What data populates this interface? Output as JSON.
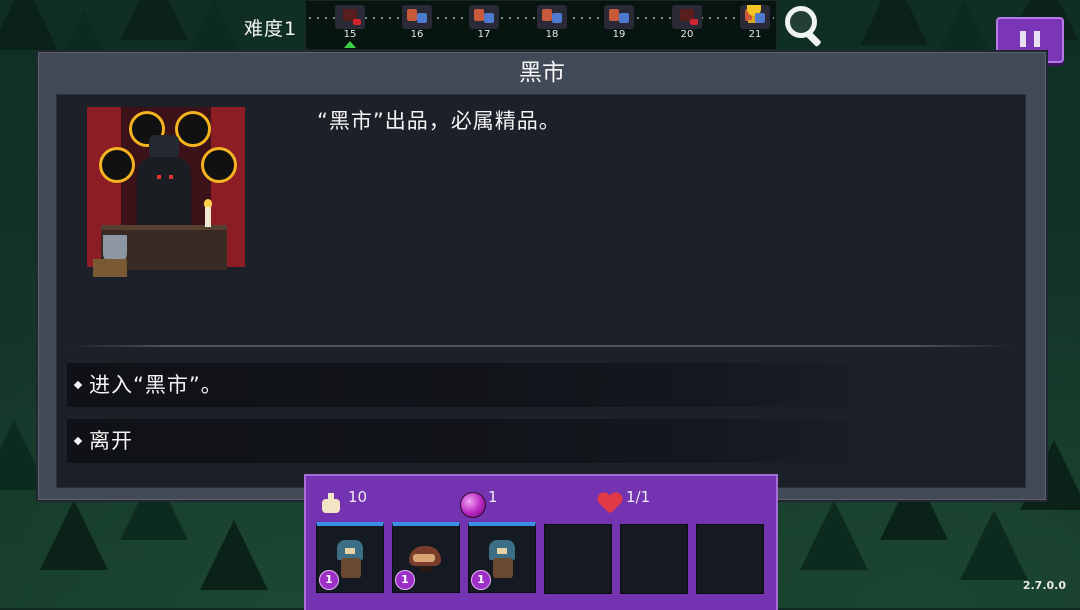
{
  "top_bar": {
    "difficulty_label": "难度1",
    "stages": [
      {
        "number": "15",
        "type": "boss",
        "current": true
      },
      {
        "number": "16",
        "type": "battle"
      },
      {
        "number": "17",
        "type": "battle"
      },
      {
        "number": "18",
        "type": "battle"
      },
      {
        "number": "19",
        "type": "battle"
      },
      {
        "number": "20",
        "type": "boss"
      },
      {
        "number": "21",
        "type": "trophy"
      }
    ]
  },
  "dialog": {
    "title": "黑市",
    "description": "“黑市”出品，必属精品。",
    "options": [
      {
        "label": "进入“黑市”。"
      },
      {
        "label": "离开"
      }
    ]
  },
  "resources": {
    "potions": "10",
    "gems": "1",
    "health": "1/1"
  },
  "team": {
    "slots": [
      {
        "filled": true,
        "level": "1",
        "hero": "feathered-warrior"
      },
      {
        "filled": true,
        "level": "1",
        "hero": "boar"
      },
      {
        "filled": true,
        "level": "1",
        "hero": "feathered-warrior"
      },
      {
        "filled": false
      },
      {
        "filled": false
      },
      {
        "filled": false
      }
    ]
  },
  "version": "2.7.0.0",
  "colors": {
    "accent_purple": "#7433b0",
    "slot_top_blue": "#3a8ee6",
    "current_stage_marker": "#3bd24a"
  }
}
